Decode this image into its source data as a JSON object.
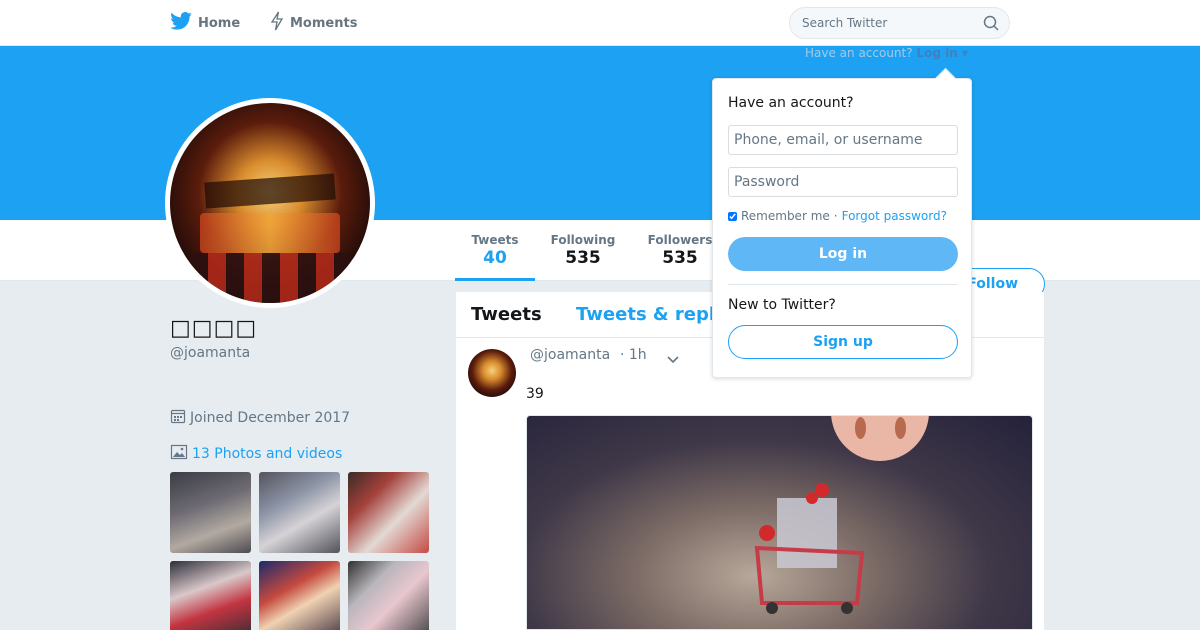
{
  "nav": {
    "home_label": "Home",
    "moments_label": "Moments",
    "search_placeholder": "Search Twitter",
    "have_account_text": "Have an account?",
    "login_link": "Log in"
  },
  "profile": {
    "name": "□□□□",
    "handle": "@joamanta",
    "joined": "Joined December 2017",
    "photos_link": "13 Photos and videos",
    "follow_label": "Follow",
    "stats": [
      {
        "label": "Tweets",
        "value": "40"
      },
      {
        "label": "Following",
        "value": "535"
      },
      {
        "label": "Followers",
        "value": "535"
      }
    ]
  },
  "timeline": {
    "tabs": [
      "Tweets",
      "Tweets & repl"
    ],
    "tweet": {
      "handle": "@joamanta",
      "time": "· 1h",
      "text": "39"
    }
  },
  "login_dropdown": {
    "title": "Have an account?",
    "username_placeholder": "Phone, email, or username",
    "password_placeholder": "Password",
    "remember_label": "Remember me",
    "separator": "·",
    "forgot_link": "Forgot password?",
    "login_button": "Log in",
    "new_label": "New to Twitter?",
    "signup_button": "Sign up"
  },
  "colors": {
    "brand": "#1da1f2",
    "banner": "#1da1f2",
    "background": "#e6ecf0"
  },
  "icons": [
    "twitter-bird-icon",
    "moments-bolt-icon",
    "search-icon",
    "calendar-icon",
    "photo-icon",
    "chevron-down-icon"
  ]
}
